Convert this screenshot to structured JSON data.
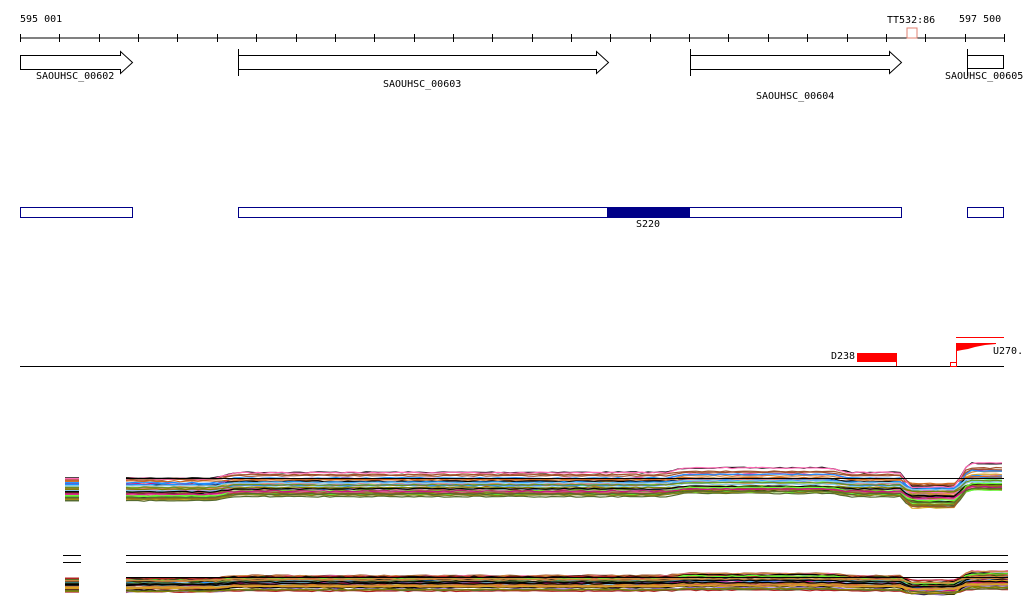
{
  "ruler": {
    "start_label": "595 001",
    "end_label": "597 500",
    "marker_label": "TT532:86"
  },
  "genes": [
    {
      "name": "SAOUHSC_00602",
      "strand": "+"
    },
    {
      "name": "SAOUHSC_00603",
      "strand": "+"
    },
    {
      "name": "SAOUHSC_00604",
      "strand": "+"
    },
    {
      "name": "SAOUHSC_00605",
      "strand": "+"
    }
  ],
  "region_track": {
    "highlight_label": "S220"
  },
  "feature_track": {
    "down_label": "D238",
    "up_label": "U270."
  },
  "colors": {
    "region": "#000088",
    "feature": "#ff0000",
    "marker": "#e08070",
    "profile_palette": [
      "#000000",
      "#8b7d1a",
      "#6b8e23",
      "#ff4500",
      "#d2691e",
      "#66ff33",
      "#9370db",
      "#c71585",
      "#87ceeb",
      "#1e90ff",
      "#ff69b4",
      "#b22222",
      "#556b2f",
      "#cd853f",
      "#f08080",
      "#a0522d",
      "#808000",
      "#daa520"
    ]
  }
}
